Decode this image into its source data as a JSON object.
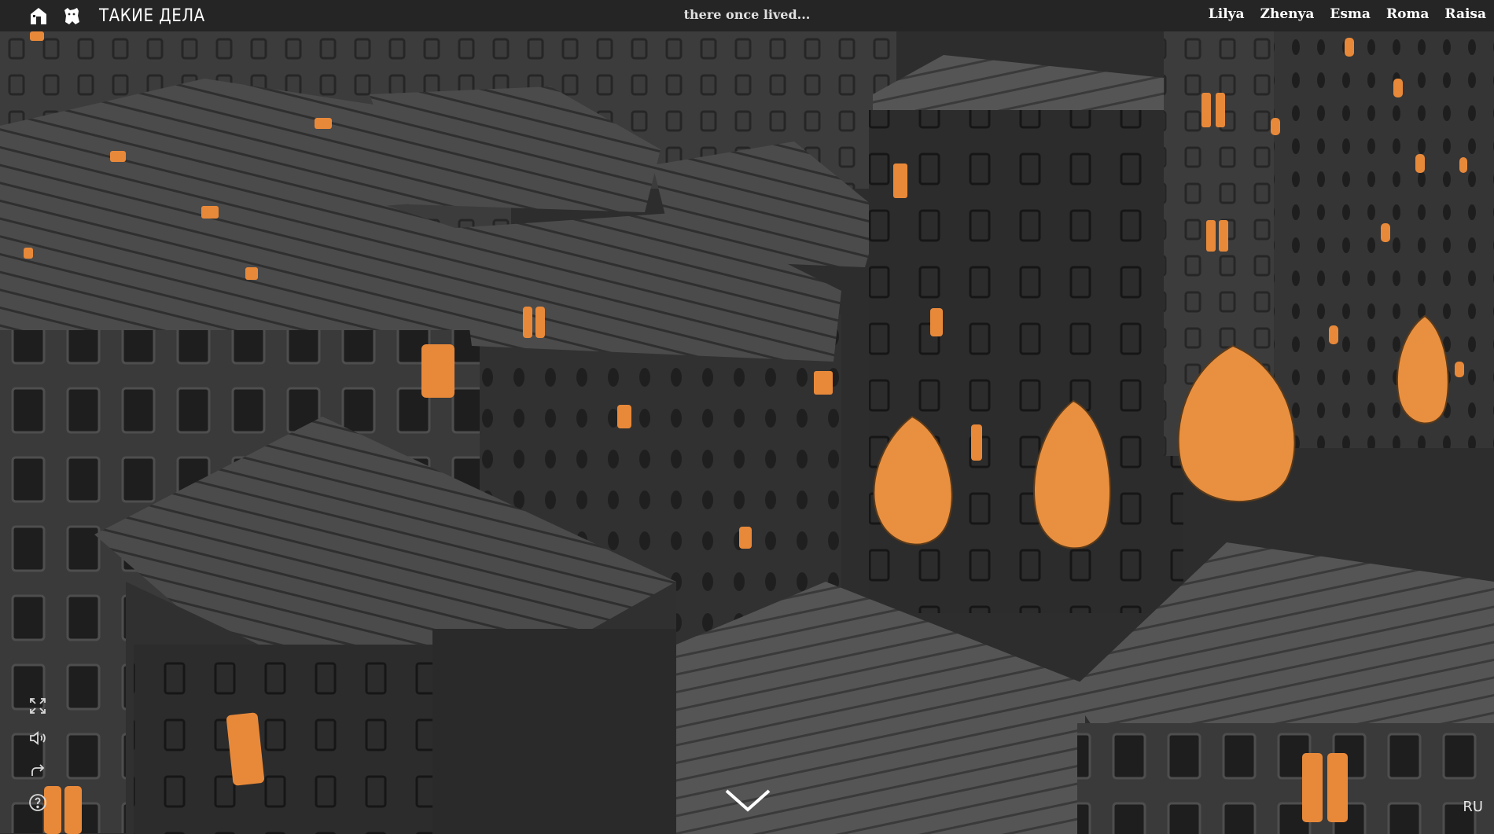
{
  "header": {
    "home_icon": "home-icon",
    "bear_icon": "bear-icon",
    "brand": "ТАКИЕ ДЕЛА",
    "tagline": "there once lived...",
    "names": [
      "Lilya",
      "Zhenya",
      "Esma",
      "Roma",
      "Raisa"
    ]
  },
  "tools": [
    "fullscreen-icon",
    "sound-icon",
    "share-icon",
    "help-icon"
  ],
  "scroll_icon": "chevron-down-icon",
  "language": "RU",
  "colors": {
    "topbar": "#252525",
    "window_lit": "#e8893a",
    "tree": "#e89040",
    "roof": "#4a4a4a",
    "wall": "#333333"
  }
}
